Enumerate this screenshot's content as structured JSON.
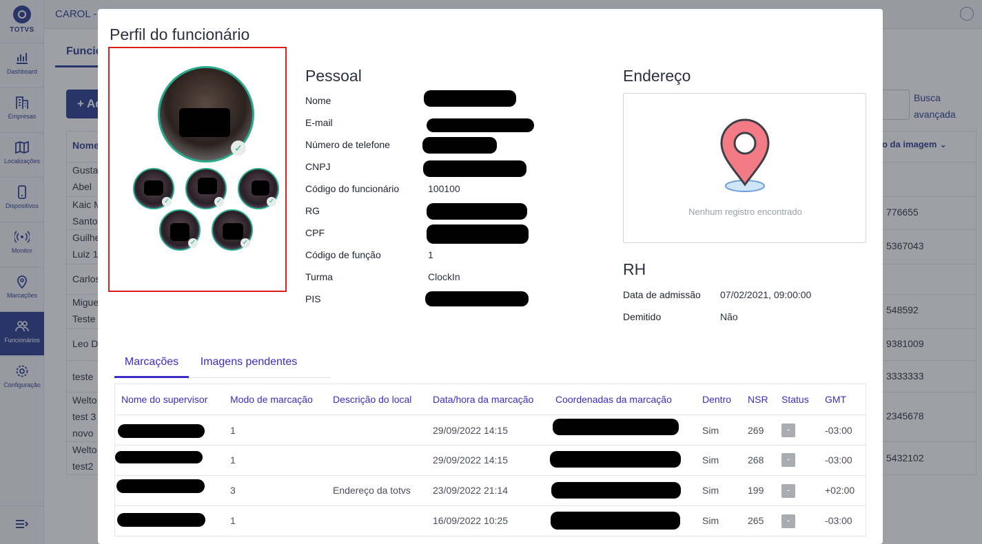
{
  "app": {
    "title": "CAROL -",
    "brand": "TOTVS",
    "accent_color": "#2a3c8f",
    "highlight_color": "#3b2bc8"
  },
  "sidebar": {
    "items": [
      {
        "label": "Dashboard",
        "icon": "bar-chart-icon"
      },
      {
        "label": "Empresas",
        "icon": "building-icon"
      },
      {
        "label": "Localizações",
        "icon": "map-icon"
      },
      {
        "label": "Dispositivos",
        "icon": "phone-icon"
      },
      {
        "label": "Monitor",
        "icon": "broadcast-icon"
      },
      {
        "label": "Marcações",
        "icon": "location-pin-icon"
      },
      {
        "label": "Funcionários",
        "icon": "users-icon",
        "active": true
      },
      {
        "label": "Configuração",
        "icon": "gear-icon"
      }
    ],
    "toggle_icon": "collapse-menu-icon"
  },
  "background": {
    "tab_label": "Funcio",
    "add_button": "+ Ad",
    "search_link": "Busca avançada",
    "column_header_left": "Nome",
    "column_header_right": "o da imagem ⌄",
    "names": [
      "Gusta",
      "Abel",
      "Kaic M",
      "Santo",
      "Guilhe",
      "Luiz 1",
      "Carlos",
      "Migue",
      "Teste",
      "Leo D",
      "teste",
      "Welto",
      "test 3",
      "novo",
      "Welto",
      "test2"
    ],
    "numbers": [
      "776655",
      "5367043",
      "548592",
      "9381009",
      "3333333",
      "2345678",
      "5432102"
    ]
  },
  "modal": {
    "title": "Perfil do funcionário",
    "pessoal": {
      "heading": "Pessoal",
      "fields": [
        {
          "label": "Nome",
          "value": ""
        },
        {
          "label": "E-mail",
          "value": ""
        },
        {
          "label": "Número de telefone",
          "value": ""
        },
        {
          "label": "CNPJ",
          "value": ""
        },
        {
          "label": "Código do funcionário",
          "value": "100100"
        },
        {
          "label": "RG",
          "value": ""
        },
        {
          "label": "CPF",
          "value": ""
        },
        {
          "label": "Código de função",
          "value": "1"
        },
        {
          "label": "Turma",
          "value": "ClockIn"
        },
        {
          "label": "PIS",
          "value": ""
        }
      ]
    },
    "endereco": {
      "heading": "Endereço",
      "empty_text": "Nenhum registro encontrado"
    },
    "rh": {
      "heading": "RH",
      "fields": [
        {
          "label": "Data de admissão",
          "value": "07/02/2021, 09:00:00"
        },
        {
          "label": "Demitido",
          "value": "Não"
        }
      ]
    },
    "tabs": [
      {
        "label": "Marcações",
        "active": true
      },
      {
        "label": "Imagens pendentes",
        "active": false
      }
    ],
    "table": {
      "headers": [
        "Nome do supervisor",
        "Modo de marcação",
        "Descrição do local",
        "Data/hora da marcação",
        "Coordenadas da marcação",
        "Dentro",
        "NSR",
        "Status",
        "GMT"
      ],
      "rows": [
        {
          "supervisor": "",
          "modo": "1",
          "descricao": "",
          "datahora": "29/09/2022 14:15",
          "coordenadas": "",
          "dentro": "Sim",
          "nsr": "269",
          "status": "-",
          "gmt": "-03:00"
        },
        {
          "supervisor": "",
          "modo": "1",
          "descricao": "",
          "datahora": "29/09/2022 14:15",
          "coordenadas": "",
          "dentro": "Sim",
          "nsr": "268",
          "status": "-",
          "gmt": "-03:00"
        },
        {
          "supervisor": "",
          "modo": "3",
          "descricao": "Endereço da totvs",
          "datahora": "23/09/2022 21:14",
          "coordenadas": "",
          "dentro": "Sim",
          "nsr": "199",
          "status": "-",
          "gmt": "+02:00"
        },
        {
          "supervisor": "",
          "modo": "1",
          "descricao": "",
          "datahora": "16/09/2022 10:25",
          "coordenadas": "",
          "dentro": "Sim",
          "nsr": "265",
          "status": "-",
          "gmt": "-03:00"
        }
      ]
    }
  }
}
